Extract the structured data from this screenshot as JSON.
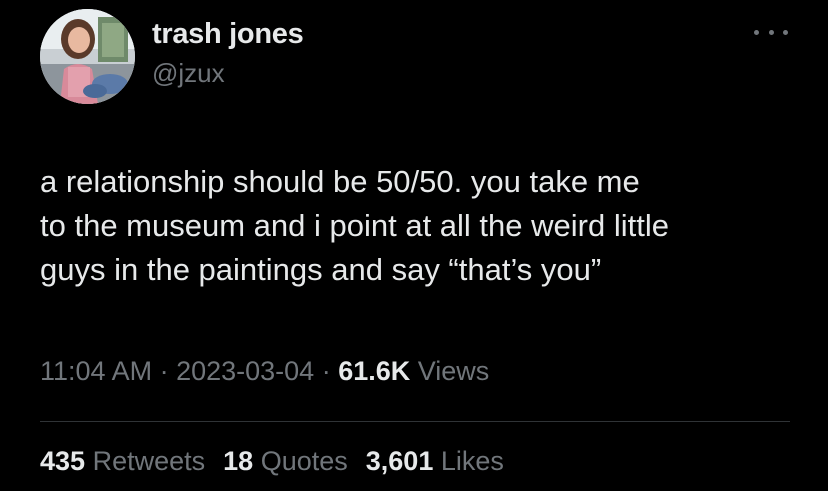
{
  "author": {
    "name": "trash jones",
    "handle": "@jzux",
    "avatar_icon": "profile-photo"
  },
  "more_icon": "more-horizontal-icon",
  "tweet": {
    "text": "a relationship should be 50/50. you take me\nto the museum and i point at all the weird little\nguys in the paintings and say “that’s you”"
  },
  "meta": {
    "time": "11:04 AM",
    "sep1": " · ",
    "date": "2023-03-04",
    "sep2": " · ",
    "views_count": "61.6K",
    "views_label": " Views"
  },
  "stats": [
    {
      "count": "435",
      "label": "Retweets"
    },
    {
      "count": "18",
      "label": "Quotes"
    },
    {
      "count": "3,601",
      "label": "Likes"
    }
  ],
  "colors": {
    "background": "#000000",
    "primary_text": "#e7e9ea",
    "secondary_text": "#71767b",
    "divider": "#2f3336"
  }
}
